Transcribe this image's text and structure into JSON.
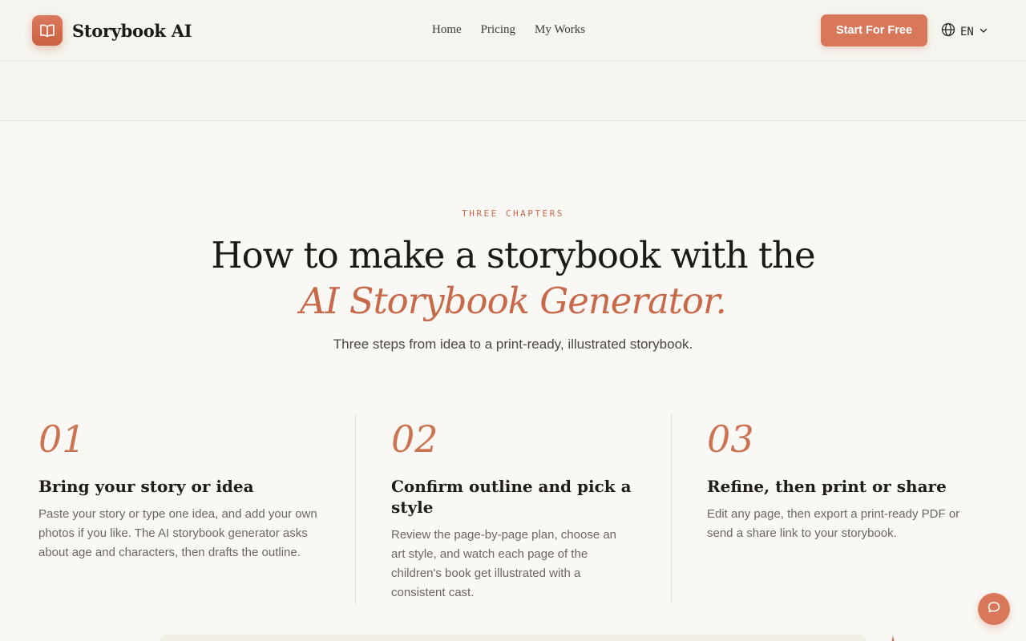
{
  "header": {
    "logo_text": "Storybook AI",
    "nav": [
      "Home",
      "Pricing",
      "My Works"
    ],
    "cta_label": "Start For Free",
    "lang": "EN"
  },
  "hero": {
    "eyebrow": "THREE CHAPTERS",
    "title_plain": "How to make a storybook with the ",
    "title_accent": "AI Storybook Generator.",
    "subtitle": "Three steps from idea to a print-ready, illustrated storybook."
  },
  "steps": [
    {
      "num": "01",
      "title": "Bring your story or idea",
      "desc": "Paste your story or type one idea, and add your own photos if you like. The AI storybook generator asks about age and characters, then drafts the outline."
    },
    {
      "num": "02",
      "title": "Confirm outline and pick a style",
      "desc": "Review the page-by-page plan, choose an art style, and watch each page of the children's book get illustrated with a consistent cast."
    },
    {
      "num": "03",
      "title": "Refine, then print or share",
      "desc": "Edit any page, then export a print-ready PDF or send a share link to your storybook."
    }
  ],
  "colors": {
    "accent": "#d9775b",
    "accent_text": "#c86a4a",
    "background": "#faf8f5"
  },
  "icons": {
    "logo": "open-book-icon",
    "lang": "globe-icon",
    "lang_caret": "chevron-down-icon",
    "chat": "chat-bubble-icon"
  }
}
